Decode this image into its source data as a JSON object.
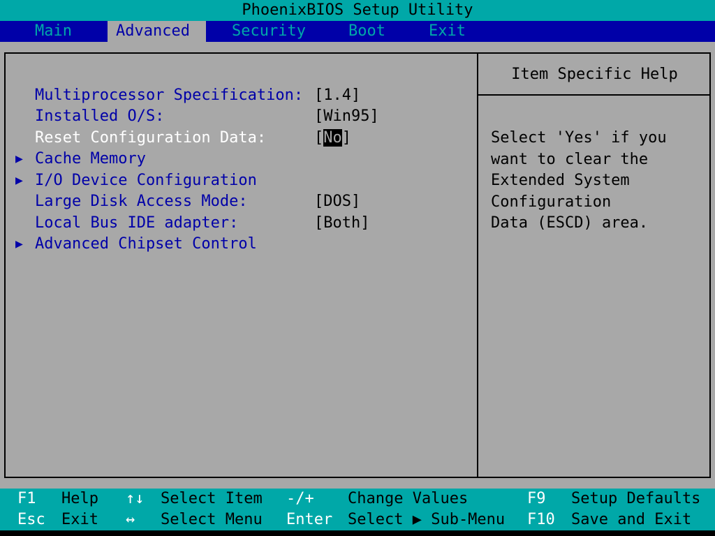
{
  "title": "PhoenixBIOS Setup Utility",
  "menu": {
    "main": "Main",
    "advanced": "Advanced",
    "security": "Security",
    "boot": "Boot",
    "exit": "Exit"
  },
  "settings": {
    "multiprocessor": {
      "label": "Multiprocessor Specification:",
      "value": "[1.4]"
    },
    "installed_os": {
      "label": "Installed O/S:",
      "value": "[Win95]"
    },
    "reset_config": {
      "label": "Reset Configuration Data:",
      "bracket_open": "[",
      "value": "No",
      "bracket_close": "]"
    },
    "cache_memory": {
      "label": "Cache Memory",
      "arrow": "▶"
    },
    "io_device": {
      "label": "I/O Device Configuration",
      "arrow": "▶"
    },
    "large_disk": {
      "label": "Large Disk Access Mode:",
      "value": "[DOS]"
    },
    "local_bus": {
      "label": "Local Bus IDE adapter:",
      "value": "[Both]"
    },
    "chipset": {
      "label": "Advanced Chipset Control",
      "arrow": "▶"
    }
  },
  "help": {
    "title": "Item Specific Help",
    "lines": [
      "Select 'Yes' if you",
      "want to clear the",
      "Extended System",
      "Configuration",
      "Data (ESCD) area."
    ]
  },
  "footer": {
    "row1": [
      {
        "key": "F1",
        "action": "Help"
      },
      {
        "key": "↑↓",
        "action": "Select Item"
      },
      {
        "key": "-/+",
        "action": "Change Values"
      },
      {
        "key": "F9",
        "action": "Setup Defaults"
      }
    ],
    "row2": [
      {
        "key": "Esc",
        "action": "Exit"
      },
      {
        "key": "↔",
        "action": "Select Menu"
      },
      {
        "key": "Enter",
        "action": "Select ▶ Sub-Menu"
      },
      {
        "key": "F10",
        "action": "Save and Exit"
      }
    ]
  },
  "colors": {
    "cyan": "#00a8a8",
    "blue": "#0000a8",
    "gray": "#a8a8a8",
    "white": "#ffffff",
    "black": "#000000"
  }
}
